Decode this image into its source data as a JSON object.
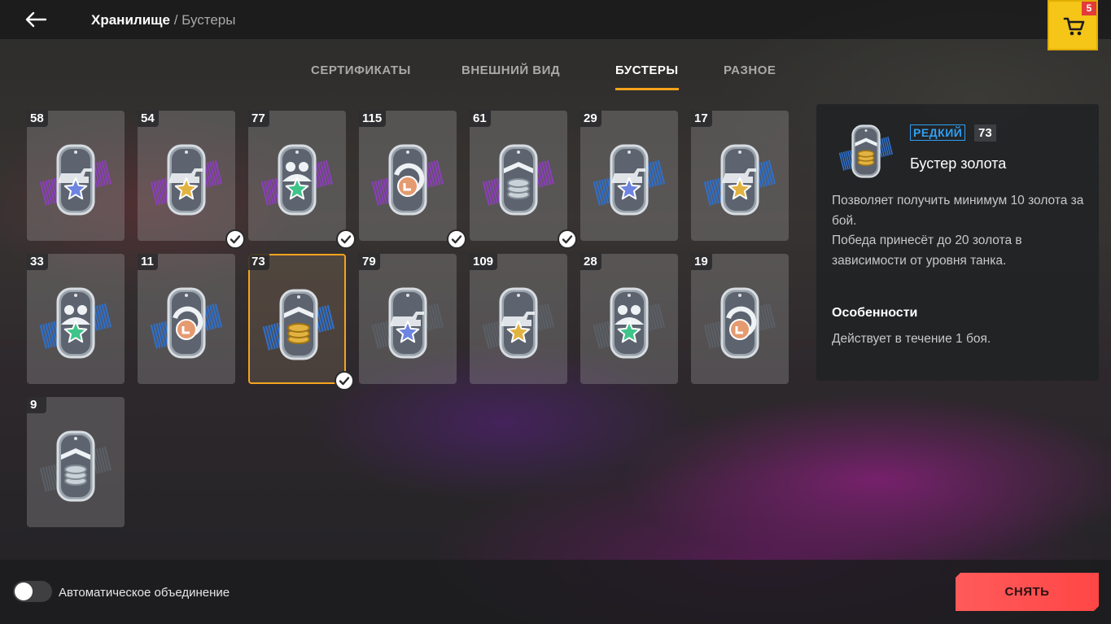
{
  "header": {
    "title": "Хранилище",
    "separator": "/",
    "subtitle": "Бустеры",
    "cart_count": "5"
  },
  "tabs": [
    {
      "label": "СЕРТИФИКАТЫ",
      "active": false
    },
    {
      "label": "ВНЕШНИЙ ВИД",
      "active": false
    },
    {
      "label": "БУСТЕРЫ",
      "active": true
    },
    {
      "label": "РАЗНОЕ",
      "active": false
    }
  ],
  "boosters": [
    {
      "count": "58",
      "symbol": "tank-star-icon",
      "rarity_color": "#8a3fb8",
      "star_color": "#6d85e0",
      "checked": false
    },
    {
      "count": "54",
      "symbol": "tank-star-icon",
      "rarity_color": "#8a3fb8",
      "star_color": "#e3b341",
      "checked": true
    },
    {
      "count": "77",
      "symbol": "crew-star-icon",
      "rarity_color": "#8a3fb8",
      "star_color": "#3fc48a",
      "checked": true
    },
    {
      "count": "115",
      "symbol": "research-icon",
      "rarity_color": "#8a3fb8",
      "star_color": "#e59a70",
      "checked": true
    },
    {
      "count": "61",
      "symbol": "silver-coins-icon",
      "rarity_color": "#8a3fb8",
      "star_color": "#b9c4cc",
      "checked": true
    },
    {
      "count": "29",
      "symbol": "tank-star-icon",
      "rarity_color": "#2f6fc9",
      "star_color": "#6d85e0",
      "checked": false
    },
    {
      "count": "17",
      "symbol": "tank-star-icon",
      "rarity_color": "#2f6fc9",
      "star_color": "#e3b341",
      "checked": false
    },
    {
      "count": "33",
      "symbol": "crew-star-icon",
      "rarity_color": "#2f6fc9",
      "star_color": "#3fc48a",
      "checked": false
    },
    {
      "count": "11",
      "symbol": "research-icon",
      "rarity_color": "#2f6fc9",
      "star_color": "#e59a70",
      "checked": false
    },
    {
      "count": "73",
      "symbol": "gold-coins-icon",
      "rarity_color": "#2f6fc9",
      "star_color": "#e3b341",
      "checked": true,
      "selected": true
    },
    {
      "count": "79",
      "symbol": "tank-star-icon",
      "rarity_color": "#5a5f66",
      "star_color": "#6d85e0",
      "checked": false
    },
    {
      "count": "109",
      "symbol": "tank-star-icon",
      "rarity_color": "#5a5f66",
      "star_color": "#e3b341",
      "checked": false
    },
    {
      "count": "28",
      "symbol": "crew-star-icon",
      "rarity_color": "#5a5f66",
      "star_color": "#3fc48a",
      "checked": false
    },
    {
      "count": "19",
      "symbol": "research-icon",
      "rarity_color": "#5a5f66",
      "star_color": "#e59a70",
      "checked": false
    },
    {
      "count": "9",
      "symbol": "silver-coins-icon",
      "rarity_color": "#5a5f66",
      "star_color": "#b9c4cc",
      "checked": false
    }
  ],
  "details": {
    "rarity": "РЕДКИЙ",
    "count": "73",
    "title": "Бустер золота",
    "description_1": "Позволяет получить минимум 10 золота за бой.",
    "description_2": "Победа принесёт до 20 золота в зависимости от уровня танка.",
    "features_heading": "Особенности",
    "features_text": "Действует в течение 1 боя."
  },
  "footer": {
    "auto_merge_label": "Автоматическое объединение",
    "auto_merge_on": false,
    "remove_button": "СНЯТЬ"
  },
  "colors": {
    "accent": "#f7a21b",
    "cart": "#f5c518",
    "rare": "#2f9ff2",
    "remove_button": "#ff4d4d"
  }
}
